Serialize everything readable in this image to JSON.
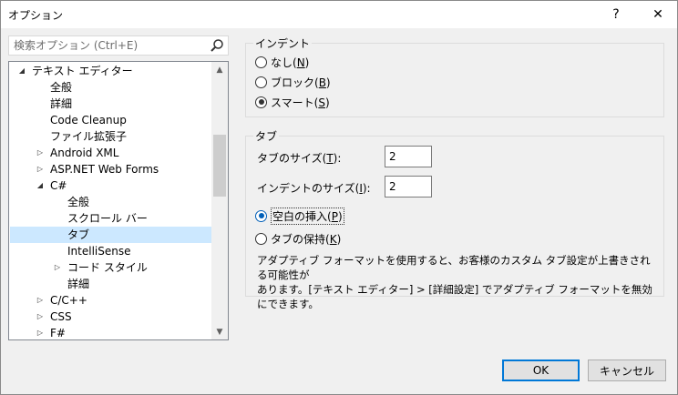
{
  "window": {
    "title": "オプション",
    "help": "?",
    "close": "✕"
  },
  "search": {
    "placeholder": "検索オプション (Ctrl+E)"
  },
  "tree": {
    "items": [
      {
        "label": "テキスト エディター",
        "arrow": "◢"
      },
      {
        "label": "全般",
        "arrow": ""
      },
      {
        "label": "詳細",
        "arrow": ""
      },
      {
        "label": "Code Cleanup",
        "arrow": ""
      },
      {
        "label": "ファイル拡張子",
        "arrow": ""
      },
      {
        "label": "Android XML",
        "arrow": "▷"
      },
      {
        "label": "ASP.NET Web Forms",
        "arrow": "▷"
      },
      {
        "label": "C#",
        "arrow": "◢"
      },
      {
        "label": "全般",
        "arrow": ""
      },
      {
        "label": "スクロール バー",
        "arrow": ""
      },
      {
        "label": "タブ",
        "arrow": ""
      },
      {
        "label": "IntelliSense",
        "arrow": ""
      },
      {
        "label": "コード スタイル",
        "arrow": "▷"
      },
      {
        "label": "詳細",
        "arrow": ""
      },
      {
        "label": "C/C++",
        "arrow": "▷"
      },
      {
        "label": "CSS",
        "arrow": "▷"
      },
      {
        "label": "F#",
        "arrow": "▷"
      }
    ],
    "scroll_up": "▲",
    "scroll_down": "▼"
  },
  "indent": {
    "title": "インデント",
    "options": [
      {
        "label": "なし(",
        "key": "N",
        "end": ")",
        "checked": false
      },
      {
        "label": "ブロック(",
        "key": "B",
        "end": ")",
        "checked": false
      },
      {
        "label": "スマート(",
        "key": "S",
        "end": ")",
        "checked": true
      }
    ]
  },
  "tabs": {
    "title": "タブ",
    "tab_size_label": "タブのサイズ(",
    "tab_size_key": "T",
    "tab_size_end": "):",
    "tab_size_value": "2",
    "indent_size_label": "インデントのサイズ(",
    "indent_size_key": "I",
    "indent_size_end": "):",
    "indent_size_value": "2",
    "insert_spaces": {
      "label": "空白の挿入(",
      "key": "P",
      "end": ")",
      "checked": true
    },
    "keep_tabs": {
      "label": "タブの保持(",
      "key": "K",
      "end": ")",
      "checked": false
    },
    "note_line1": "アダプティブ フォーマットを使用すると、お客様のカスタム タブ設定が上書きされる可能性が",
    "note_line2": "あります。[テキスト エディター] > [詳細設定] でアダプティブ フォーマットを無効にできます。"
  },
  "buttons": {
    "ok": "OK",
    "cancel": "キャンセル"
  }
}
